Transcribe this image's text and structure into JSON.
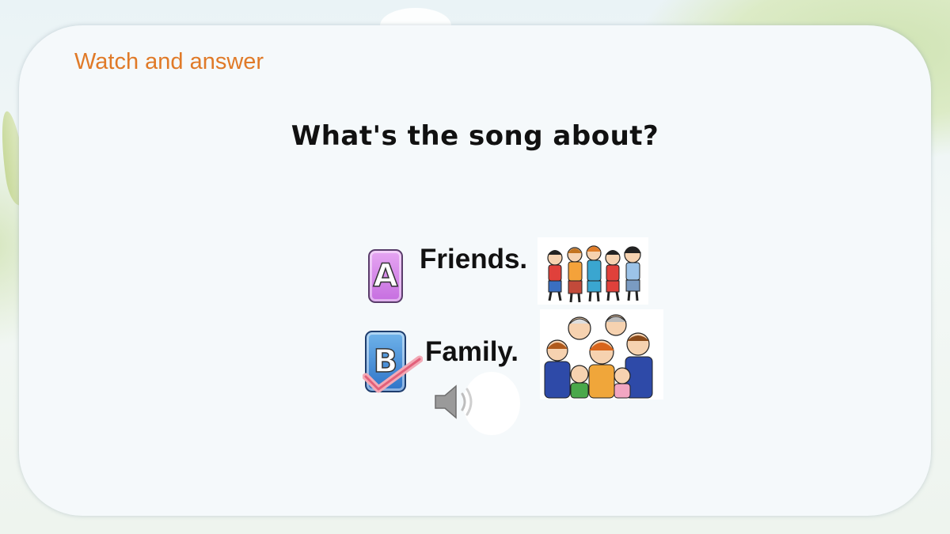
{
  "slide": {
    "heading": "Watch and answer",
    "question": "What's the song about?",
    "options": [
      {
        "letter": "A",
        "text": "Friends.",
        "image": "friends-picture",
        "correct": false
      },
      {
        "letter": "B",
        "text": "Family.",
        "image": "family-picture",
        "correct": true
      }
    ],
    "icons": {
      "correct_mark": "checkmark-icon",
      "audio": "speaker-icon"
    }
  }
}
